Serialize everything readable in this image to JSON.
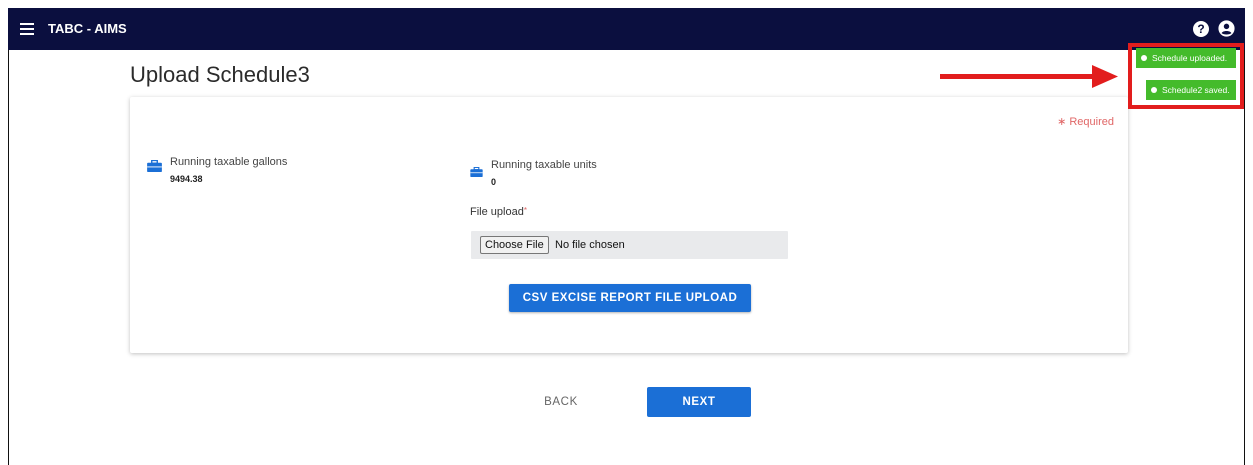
{
  "topbar": {
    "app_title": "TABC - AIMS",
    "help_icon": "question-circle-icon",
    "user_icon": "user-circle-icon",
    "menu_icon": "hamburger-menu-icon"
  },
  "page": {
    "title": "Upload Schedule3"
  },
  "form": {
    "required_label": "∗ Required",
    "gallons": {
      "label": "Running taxable gallons",
      "value": "9494.38",
      "icon": "briefcase-icon"
    },
    "units": {
      "label": "Running taxable units",
      "value": "0",
      "icon": "briefcase-icon"
    },
    "file_upload_label": "File upload",
    "file_upload_required_mark": "*",
    "choose_file_label": "Choose File",
    "no_file_text": "No file chosen",
    "csv_button_label": "CSV EXCISE REPORT FILE UPLOAD"
  },
  "nav": {
    "back_label": "BACK",
    "next_label": "NEXT"
  },
  "toasts": [
    {
      "text": "Schedule uploaded."
    },
    {
      "text": "Schedule2 saved."
    }
  ],
  "colors": {
    "topbar": "#0b0f3f",
    "primary": "#1b6fd6",
    "toast": "#44bb2b",
    "highlight": "#e21d1d",
    "required": "#e06666"
  }
}
